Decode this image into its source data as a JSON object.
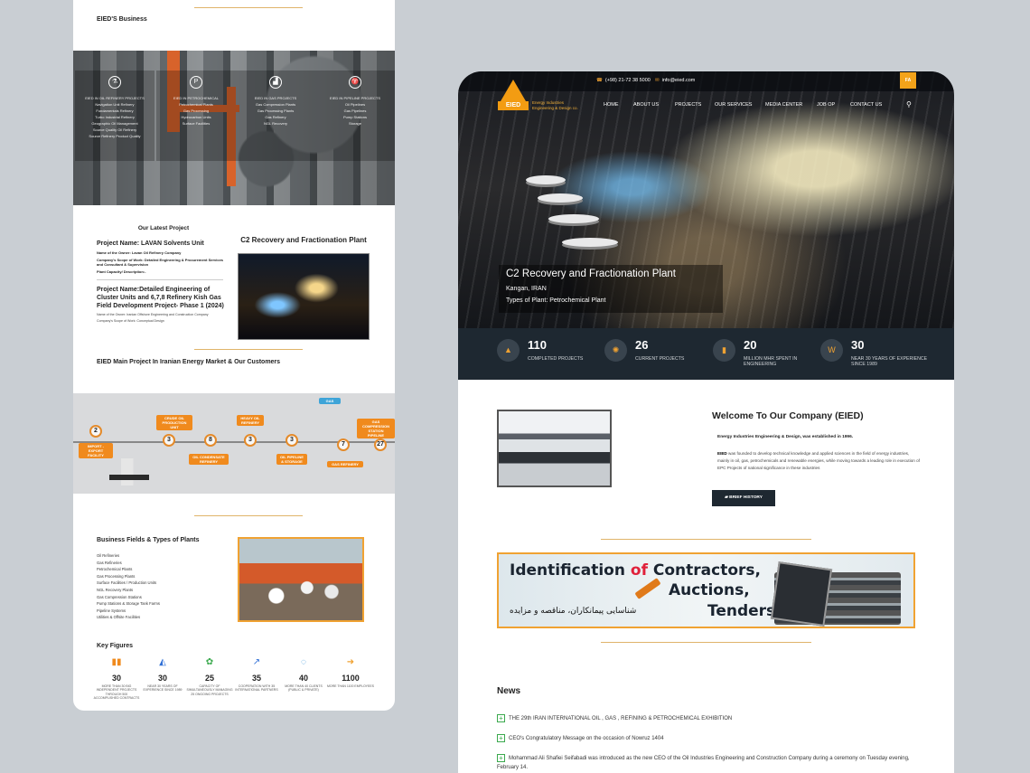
{
  "left": {
    "business_title": "EIED'S Business",
    "business_cols": [
      {
        "icon": "flask-icon",
        "glyph": "⚗",
        "title": "EIED IN OIL REFINERY PROJECTS",
        "lines": [
          "Navigation Unit Refinery",
          "Fundamentals Refinery",
          "Turbo Industrial Refinery",
          "Geographic Oil Management",
          "Source Quality Oil Refinery",
          "Source Refinery Product Quality"
        ]
      },
      {
        "icon": "p-icon",
        "glyph": "P",
        "title": "EIED IN PETROCHEMICAL",
        "lines": [
          "Petrochemical Plants",
          "Gas Processing",
          "Hydrocarbon Units",
          "Surface Facilities"
        ]
      },
      {
        "icon": "factory-icon",
        "glyph": "▟",
        "title": "EIED IN GAS PROJECTS",
        "lines": [
          "Gas Compression Plants",
          "Gas Processing Plants",
          "Gas Refinery",
          "NGL Recovery"
        ]
      },
      {
        "icon": "pipeline-icon",
        "glyph": "♈",
        "title": "EIED IN PIPELINE PROJECTS",
        "lines": [
          "Oil Pipelines",
          "Gas Pipelines",
          "Pump Stations",
          "Storage"
        ]
      }
    ],
    "latest_title": "Our Latest Project",
    "project1": {
      "name": "Project Name: LAVAN Solvents Unit",
      "owner": "Name of the Owner: Lavan Oil Refinery Company",
      "scope": "Company's Scope of Work: Detailed Engineering & Procurement Services and Consultant & Supervision",
      "capacity": "Plant Capacity/ Description:-"
    },
    "project2": {
      "name": "Project Name:Detailed Engineering of Cluster Units and 6,7,8 Refinery Kish Gas Field Development Project- Phase 1 (2024)",
      "owner": "Name of the Owner: Iranian Offshore Engineering and Construction Company",
      "scope": "Company's Scope of Work: Conceptual Design"
    },
    "c2_title": "C2 Recovery and Fractionation Plant",
    "main_project_title": "EIED Main Project In Iranian Energy Market & Our Customers",
    "diagram": {
      "nodes": [
        "2",
        "3",
        "8",
        "3",
        "3",
        "7",
        "27"
      ],
      "tags": [
        "CRUDE OIL PRODUCTION UNIT",
        "HEAVY OIL REFINERY",
        "IMPORT - EXPORT FACILITY",
        "OIL CONDENSATE REFINERY",
        "OIL PIPELINE & STORAGE",
        "GAS REFINERY",
        "GAS COMPRESSION STATION PIPELINE",
        "GAS"
      ]
    },
    "fields_title": "Business Fields & Types of Plants",
    "fields": [
      "Oil Refineries",
      "Gas Refineries",
      "Petrochemical Plants",
      "Gas Processing Plants",
      "Surface Facilities / Production Units",
      "NGL Recovery Plants",
      "Gas Compression Stations",
      "Pump Stations & Storage Tank Farms",
      "Pipeline Systems",
      "Utilities & Offsite Facilities"
    ],
    "key_title": "Key Figures",
    "key_figures": [
      {
        "icon": "bar-chart-icon",
        "glyph": "▮▮",
        "color": "#f08a1d",
        "num": "30",
        "desc": "MORE THAN 30 BIG INDEPENDENT PROJECTS THROUGH 500 ACCOMPLISHED CONTRACTS"
      },
      {
        "icon": "area-chart-icon",
        "glyph": "◭",
        "color": "#2f6fd6",
        "num": "30",
        "desc": "NEAR 30 YEARS OF EXPERIENCE SINCE 1989"
      },
      {
        "icon": "gear-icon",
        "glyph": "✿",
        "color": "#3aa94d",
        "num": "25",
        "desc": "CAPACITY OF SIMULTANEOUSLY MANAGING 25 ONGOING PROJECTS"
      },
      {
        "icon": "line-chart-icon",
        "glyph": "↗",
        "color": "#2f6fd6",
        "num": "35",
        "desc": "COOPERATION WITH 35 INTERNATIONAL PARTNERS"
      },
      {
        "icon": "spinner-icon",
        "glyph": "◌",
        "color": "#2f8fd6",
        "num": "40",
        "desc": "MORE THAN 40 CLIENTS (PUBLIC & PRIVATE)"
      },
      {
        "icon": "arrow-circle-icon",
        "glyph": "➜",
        "color": "#f0a232",
        "num": "1100",
        "desc": "MORE THAN 1100 EMPLOYEES"
      }
    ]
  },
  "right": {
    "phone": "(+98) 21-72 38 5000",
    "email": "info@eied.com",
    "lang_button": "FA",
    "logo_text": "EIED",
    "logo_sub": "Energy Industries Engineering & Design co.",
    "nav": [
      "HOME",
      "ABOUT US",
      "PROJECTS",
      "OUR SERVICES",
      "MEDIA CENTER",
      "JOB OP",
      "CONTACT US"
    ],
    "hero": {
      "title": "C2 Recovery and Fractionation Plant",
      "location": "Kangan, IRAN",
      "type": "Types of Plant: Petrochemical Plant"
    },
    "stats": [
      {
        "icon": "chart-icon",
        "glyph": "▲",
        "num": "110",
        "desc": "COMPLETED PROJECTS"
      },
      {
        "icon": "cog-icon",
        "glyph": "✺",
        "num": "26",
        "desc": "CURRENT PROJECTS"
      },
      {
        "icon": "bar-chart-icon",
        "glyph": "▮",
        "num": "20",
        "desc": "MILLION MHR SPENT IN ENGINEERING"
      },
      {
        "icon": "graph-icon",
        "glyph": "W",
        "num": "30",
        "desc": "NEAR 30 YEARS OF EXPERIENCE SINCE 1989"
      }
    ],
    "welcome_title": "Welcome To Our Company (EIED)",
    "welcome_line1": "Energy Industries Engineering & Design, was established in 1996.",
    "welcome_lead": "EIED",
    "welcome_body": " was founded to develop technical knowledge and applied sciences in the field of energy industries, mainly in oil, gas, petrochemicals and renewable energies, while moving towards a leading role in execution of EPC Projects of national significance in these industries",
    "brief_button": "BRIEF HISTORY",
    "banner": {
      "line1a": "Identification ",
      "line1b": "of",
      "line1c": " Contractors,",
      "line2": "Auctions,",
      "line3": "Tenders",
      "persian": "شناسایی پیمانکاران، مناقصه و مزایده"
    },
    "news_title": "News",
    "news": [
      "THE 29th IRAN INTERNATIONAL OIL , GAS , REFINING & PETROCHEMICAL EXHIBITION",
      "CEO's Congratulatory Message on the occasion of Nowruz 1404",
      "Mohammad Ali Shafiei Seifabadi was introduced as the new CEO of the Oil Industries Engineering and Construction Company during a ceremony on Tuesday evening, February 14."
    ]
  }
}
